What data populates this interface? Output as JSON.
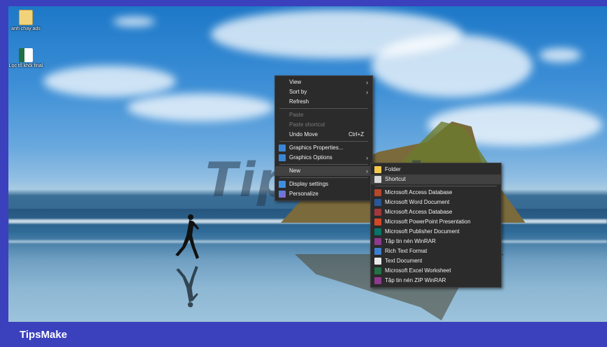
{
  "desktop": {
    "icons": [
      {
        "label": "anh chay ads",
        "icon": "text-file-icon"
      },
      {
        "label": "Lọc tổ khối final",
        "icon": "excel-file-icon"
      }
    ],
    "watermark": "TipsMake"
  },
  "context_menu": {
    "items": [
      {
        "label": "View",
        "submenu": true
      },
      {
        "label": "Sort by",
        "submenu": true
      },
      {
        "label": "Refresh"
      },
      {
        "label": "Paste",
        "disabled": true
      },
      {
        "label": "Paste shortcut",
        "disabled": true
      },
      {
        "label": "Undo Move",
        "shortcut": "Ctrl+Z"
      },
      {
        "label": "Graphics Properties...",
        "icon": "intel-graphics-icon"
      },
      {
        "label": "Graphics Options",
        "icon": "intel-graphics-icon",
        "submenu": true
      },
      {
        "label": "New",
        "submenu": true
      },
      {
        "label": "Display settings",
        "icon": "display-icon"
      },
      {
        "label": "Personalize",
        "icon": "personalize-icon"
      }
    ]
  },
  "new_submenu": {
    "items": [
      {
        "label": "Folder",
        "icon": "folder-icon",
        "color": "#f3c94b"
      },
      {
        "label": "Shortcut",
        "icon": "shortcut-icon",
        "color": "#d8d8d8"
      },
      {
        "label": "Microsoft Access Database",
        "icon": "access-icon",
        "color": "#b7472a"
      },
      {
        "label": "Microsoft Word Document",
        "icon": "word-icon",
        "color": "#2b579a"
      },
      {
        "label": "Microsoft Access Database",
        "icon": "access-icon",
        "color": "#a4373a"
      },
      {
        "label": "Microsoft PowerPoint Presentation",
        "icon": "powerpoint-icon",
        "color": "#d24726"
      },
      {
        "label": "Microsoft Publisher Document",
        "icon": "publisher-icon",
        "color": "#077568"
      },
      {
        "label": "Tập tin nén WinRAR",
        "icon": "winrar-icon",
        "color": "#8e3a8e"
      },
      {
        "label": "Rich Text Format",
        "icon": "wordpad-icon",
        "color": "#3c7fd0"
      },
      {
        "label": "Text Document",
        "icon": "text-document-icon",
        "color": "#e8e8e8"
      },
      {
        "label": "Microsoft Excel Worksheet",
        "icon": "excel-icon",
        "color": "#217346"
      },
      {
        "label": "Tập tin nén ZIP WinRAR",
        "icon": "winrar-zip-icon",
        "color": "#8e3a8e"
      }
    ]
  },
  "footer": {
    "brand": "TipsMake"
  }
}
